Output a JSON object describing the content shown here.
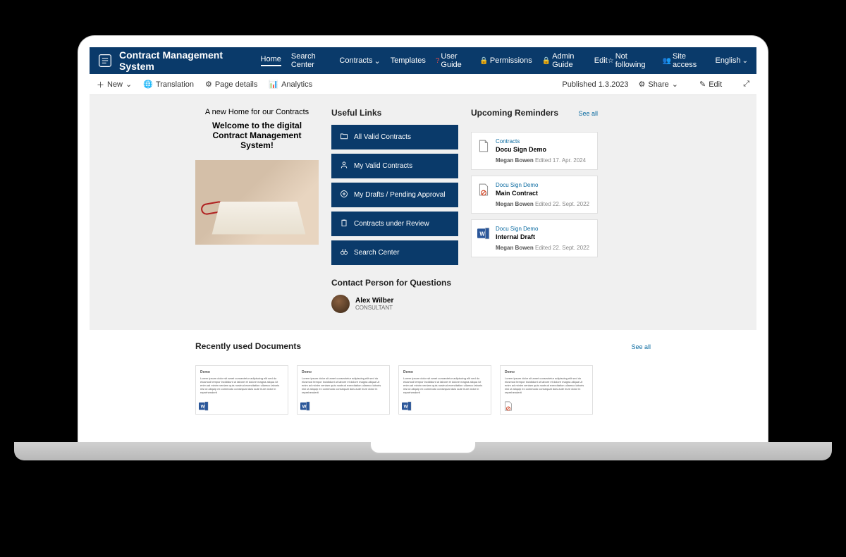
{
  "app": {
    "title": "Contract Management System"
  },
  "nav": {
    "items": [
      {
        "label": "Home",
        "active": true
      },
      {
        "label": "Search Center"
      },
      {
        "label": "Contracts",
        "dropdown": true
      },
      {
        "label": "Templates"
      },
      {
        "label": "User Guide",
        "prefix": "qmark",
        "prefixText": "?"
      },
      {
        "label": "Permissions",
        "prefix": "lock"
      },
      {
        "label": "Admin Guide",
        "prefix": "lock"
      },
      {
        "label": "Edit"
      }
    ],
    "right": {
      "following": "Not following",
      "siteaccess": "Site access",
      "language": "English"
    }
  },
  "cmdbar": {
    "left": [
      {
        "label": "New",
        "icon": "plus",
        "dropdown": true
      },
      {
        "label": "Translation",
        "icon": "translate"
      },
      {
        "label": "Page details",
        "icon": "gear"
      },
      {
        "label": "Analytics",
        "icon": "chart"
      }
    ],
    "right": {
      "published": "Published 1.3.2023",
      "share": "Share",
      "edit": "Edit"
    }
  },
  "hero": {
    "eyebrow": "A new Home for our Contracts",
    "headline": "Welcome to the digital Contract Management System!"
  },
  "useful_links": {
    "title": "Useful Links",
    "items": [
      {
        "label": "All Valid Contracts",
        "icon": "folder"
      },
      {
        "label": "My Valid Contracts",
        "icon": "person"
      },
      {
        "label": "My Drafts / Pending Approval",
        "icon": "plus-circle"
      },
      {
        "label": "Contracts under Review",
        "icon": "clipboard"
      },
      {
        "label": "Search Center",
        "icon": "binoculars"
      }
    ]
  },
  "contact": {
    "title": "Contact Person for Questions",
    "name": "Alex Wilber",
    "role": "CONSULTANT"
  },
  "reminders": {
    "title": "Upcoming Reminders",
    "seeall": "See all",
    "items": [
      {
        "category": "Contracts",
        "title": "Docu Sign Demo",
        "author": "Megan Bowen",
        "edited": "Edited 17. Apr. 2024",
        "icon": "plain"
      },
      {
        "category": "Docu Sign Demo",
        "title": "Main Contract",
        "author": "Megan Bowen",
        "edited": "Edited 22. Sept. 2022",
        "icon": "blocked"
      },
      {
        "category": "Docu Sign Demo",
        "title": "Internal Draft",
        "author": "Megan Bowen",
        "edited": "Edited 22. Sept. 2022",
        "icon": "word"
      }
    ]
  },
  "recent": {
    "title": "Recently used Documents",
    "seeall": "See all",
    "docs": [
      {
        "icon": "word"
      },
      {
        "icon": "word"
      },
      {
        "icon": "word"
      },
      {
        "icon": "blocked"
      }
    ]
  }
}
